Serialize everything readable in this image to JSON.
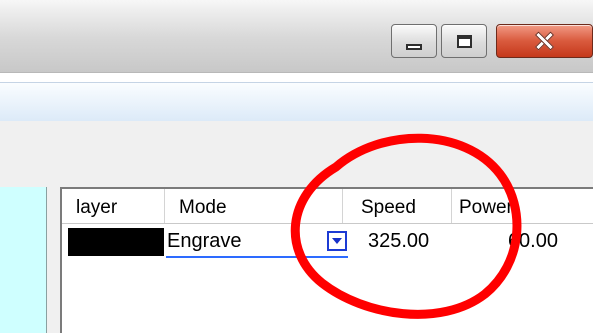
{
  "window": {
    "controls": {
      "minimize_icon": "minimize-icon",
      "maximize_icon": "maximize-icon",
      "close_icon": "close-icon"
    },
    "accent_colors": {
      "close_button": "#c93b1f",
      "annotation_circle": "#ff0000",
      "layer_swatch": "#000000",
      "dropdown_border": "#1c3bd4"
    }
  },
  "layer_table": {
    "columns": {
      "layer": "layer",
      "mode": "Mode",
      "speed": "Speed",
      "power": "Power"
    },
    "rows": [
      {
        "layer_color": "#000000",
        "mode": "Engrave",
        "speed": "325.00",
        "power": "60.00"
      }
    ],
    "dropdown_icon": "dropdown-arrow-icon"
  }
}
